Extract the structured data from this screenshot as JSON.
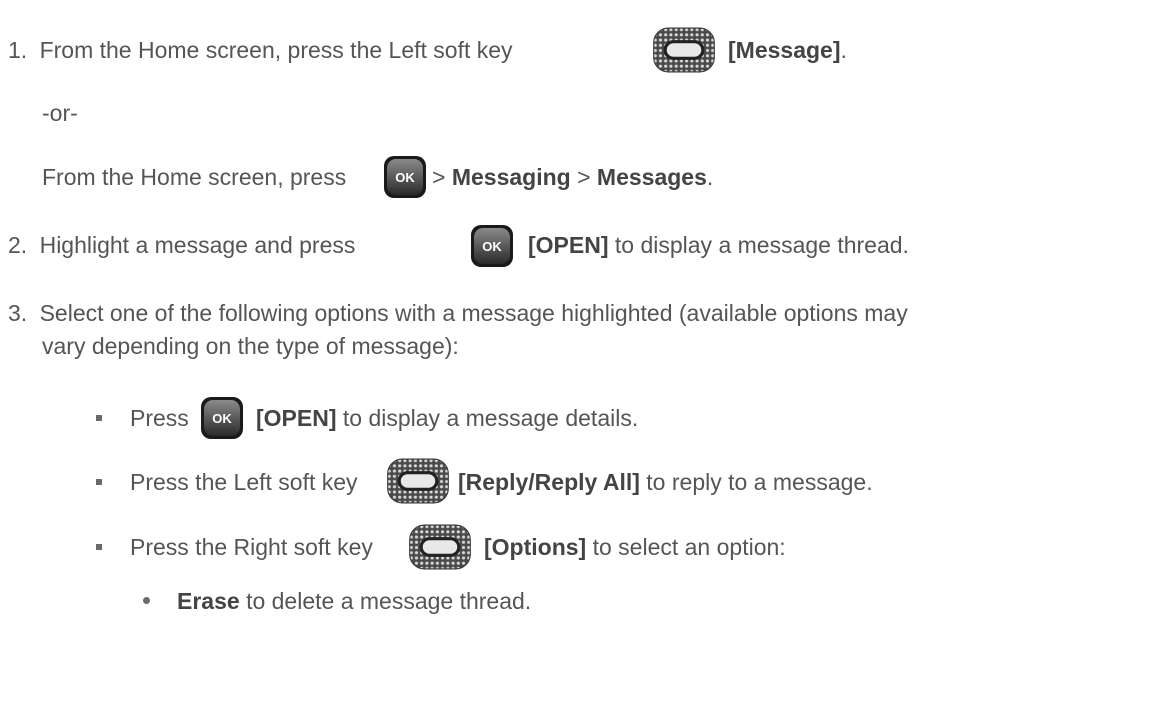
{
  "step1": {
    "number": "1.",
    "text": "From the Home screen, press the Left soft key",
    "key_label": "[Message]",
    "end": ".",
    "or": "-or-",
    "alt_pre": "From the Home screen, press",
    "sep1": ">",
    "menu1": "Messaging",
    "sep2": ">",
    "menu2": "Messages",
    "alt_end": "."
  },
  "step2": {
    "number": "2.",
    "pre": "Highlight a message and press",
    "key_label": "[OPEN]",
    "post": "to display a message thread."
  },
  "step3": {
    "number": "3.",
    "line1": "Select one of the following options with a message highlighted (available options may",
    "line2": "vary depending on the type of message):",
    "bullets": [
      {
        "pre": "Press",
        "key_label": "[OPEN]",
        "post": "to display a message details."
      },
      {
        "pre": "Press the Left soft key",
        "key_label": "[Reply/Reply All]",
        "post": "to reply to a message."
      },
      {
        "pre": "Press the Right soft key",
        "key_label": "[Options]",
        "post": "to select an option:"
      }
    ],
    "sub": {
      "term": "Erase",
      "post": "to delete a message thread."
    }
  },
  "icons": {
    "ok_label": "OK"
  }
}
